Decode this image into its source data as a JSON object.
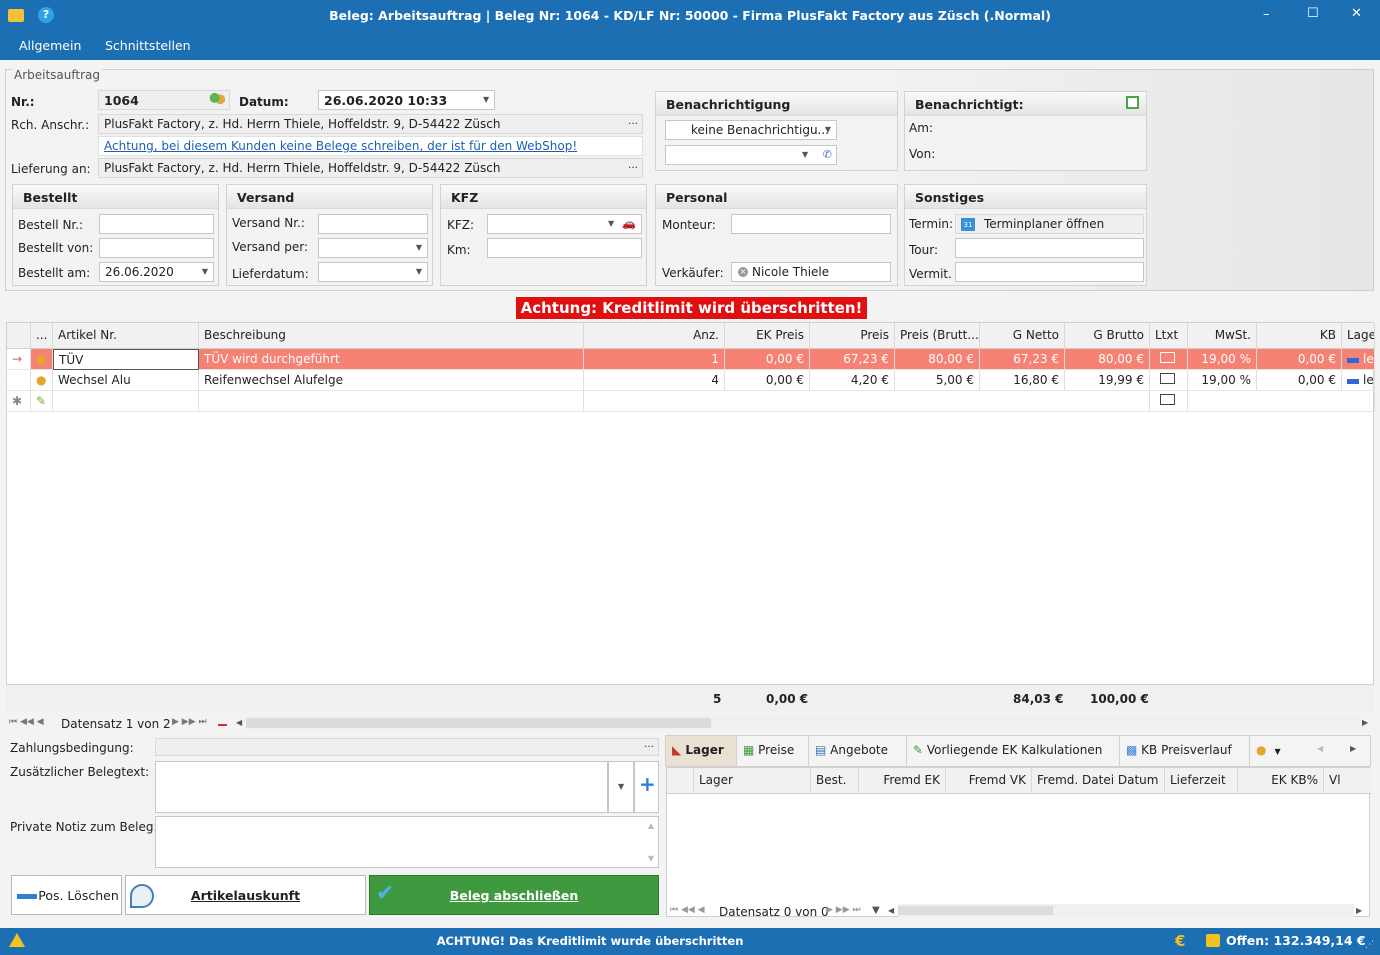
{
  "window": {
    "title": "Beleg: Arbeitsauftrag | Beleg Nr: 1064 - KD/LF Nr: 50000 - Firma PlusFakt Factory aus Züsch (.Normal)",
    "minimize": "–",
    "maximize": "☐",
    "close": "✕"
  },
  "menu": [
    "Allgemein",
    "Schnittstellen"
  ],
  "group_title": "Arbeitsauftrag",
  "header": {
    "nr_label": "Nr.:",
    "nr_value": "1064",
    "datum_label": "Datum:",
    "datum_value": "26.06.2020 10:33",
    "rch_label": "Rch. Anschr.:",
    "rch_value": "PlusFakt Factory, z. Hd. Herrn Thiele, Hoffeldstr. 9, D-54422 Züsch",
    "warning_link": "Achtung, bei diesem Kunden keine Belege schreiben, der ist für den WebShop!",
    "lief_label": "Lieferung an:",
    "lief_value": "PlusFakt Factory, z. Hd. Herrn Thiele, Hoffeldstr. 9, D-54422 Züsch"
  },
  "benachrichtigung": {
    "title": "Benachrichtigung",
    "value": "keine Benachrichtigu..."
  },
  "benachrichtigt": {
    "title": "Benachrichtigt:",
    "am": "Am:",
    "von": "Von:"
  },
  "bestellt": {
    "title": "Bestellt",
    "nr": "Bestell Nr.:",
    "von": "Bestellt von:",
    "am": "Bestellt am:",
    "am_value": "26.06.2020"
  },
  "versand": {
    "title": "Versand",
    "nr": "Versand Nr.:",
    "per": "Versand per:",
    "lieferdatum": "Lieferdatum:"
  },
  "kfz": {
    "title": "KFZ",
    "kfz": "KFZ:",
    "km": "Km:"
  },
  "personal": {
    "title": "Personal",
    "monteur": "Monteur:",
    "verkaeufer": "Verkäufer:",
    "verkaeufer_value": "Nicole Thiele"
  },
  "sonstiges": {
    "title": "Sonstiges",
    "termin": "Termin:",
    "termin_value": "Terminplaner öffnen",
    "tour": "Tour:",
    "vermit": "Vermit."
  },
  "credit_warning": "Achtung: Kreditlimit wird überschritten!",
  "grid": {
    "columns": [
      "...",
      "Artikel Nr.",
      "Beschreibung",
      "Anz.",
      "EK Preis",
      "Preis",
      "Preis (Brutt...",
      "G Netto",
      "G Brutto",
      "Ltxt",
      "MwSt.",
      "KB",
      "Lage"
    ],
    "rows": [
      {
        "artikel": "TÜV",
        "beschreibung": "TÜV wird durchgeführt",
        "anz": "1",
        "ek": "0,00 €",
        "preis": "67,23 €",
        "brutto": "80,00 €",
        "gnetto": "67,23 €",
        "gbrutto": "80,00 €",
        "mwst": "19,00 %",
        "kb": "0,00 €",
        "lage": "le"
      },
      {
        "artikel": "Wechsel Alu",
        "beschreibung": "Reifenwechsel Alufelge",
        "anz": "4",
        "ek": "0,00 €",
        "preis": "4,20 €",
        "brutto": "5,00 €",
        "gnetto": "16,80 €",
        "gbrutto": "19,99 €",
        "mwst": "19,00 %",
        "kb": "0,00 €",
        "lage": "le"
      }
    ],
    "totals": {
      "anz": "5",
      "ek": "0,00 €",
      "gnetto": "84,03 €",
      "gbrutto": "100,00 €"
    },
    "nav": "Datensatz 1 von 2"
  },
  "bottom": {
    "zahlung": "Zahlungsbedingung:",
    "zusatz": "Zusätzlicher Belegtext:",
    "notiz": "Private Notiz zum Beleg:"
  },
  "buttons": {
    "pos_loeschen": "Pos. Löschen",
    "artikelauskunft": "Artikelauskunft",
    "abschliessen": "Beleg abschließen"
  },
  "tabs": [
    "Lager",
    "Preise",
    "Angebote",
    "Vorliegende EK Kalkulationen",
    "KB Preisverlauf"
  ],
  "lager": {
    "columns": [
      "Lager",
      "Best.",
      "Fremd EK",
      "Fremd VK",
      "Fremd. Datei Datum",
      "Lieferzeit",
      "EK KB%",
      "Vl"
    ],
    "nav": "Datensatz 0 von 0"
  },
  "status": {
    "message": "ACHTUNG! Das Kreditlimit wurde überschritten",
    "offen": "Offen: 132.349,14 €"
  }
}
